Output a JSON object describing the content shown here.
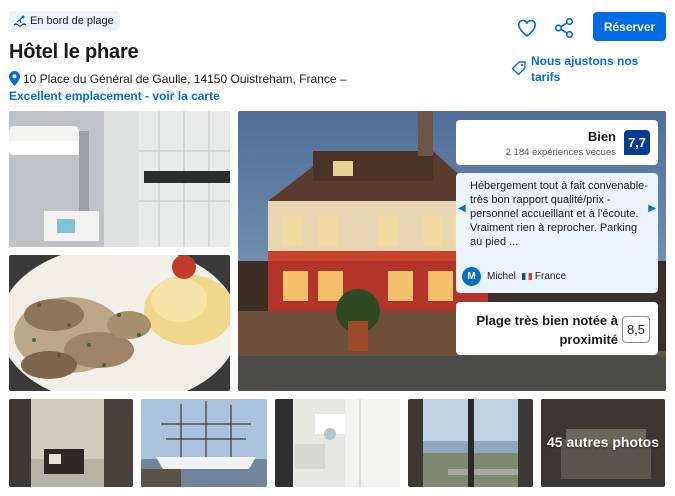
{
  "badge": {
    "label": "En bord de plage"
  },
  "hotel": {
    "name": "Hôtel le phare",
    "address": "10 Place du Général de Gaulle, 14150 Ouistreham, France –",
    "location_link": "Excellent emplacement - voir la carte"
  },
  "actions": {
    "reserve_label": "Réserver",
    "price_match": "Nous ajustons nos tarifs"
  },
  "score": {
    "word": "Bien",
    "count": "2 184 expériences vécues",
    "value": "7,7"
  },
  "review": {
    "text": "Hébergement tout à fait convenable- très bon rapport qualité/prix - personnel accueillant et à l'écoute. Vraiment rien à reprocher. Parking au pied ...",
    "initial": "M",
    "author": "Michel",
    "country": "France"
  },
  "beach": {
    "label": "Plage très bien notée à proximité",
    "value": "8,5"
  },
  "gallery": {
    "more_photos": "45 autres photos"
  },
  "colors": {
    "accent": "#006ce4",
    "score_bg": "#003b95",
    "review_bg": "#ebf3ff"
  }
}
